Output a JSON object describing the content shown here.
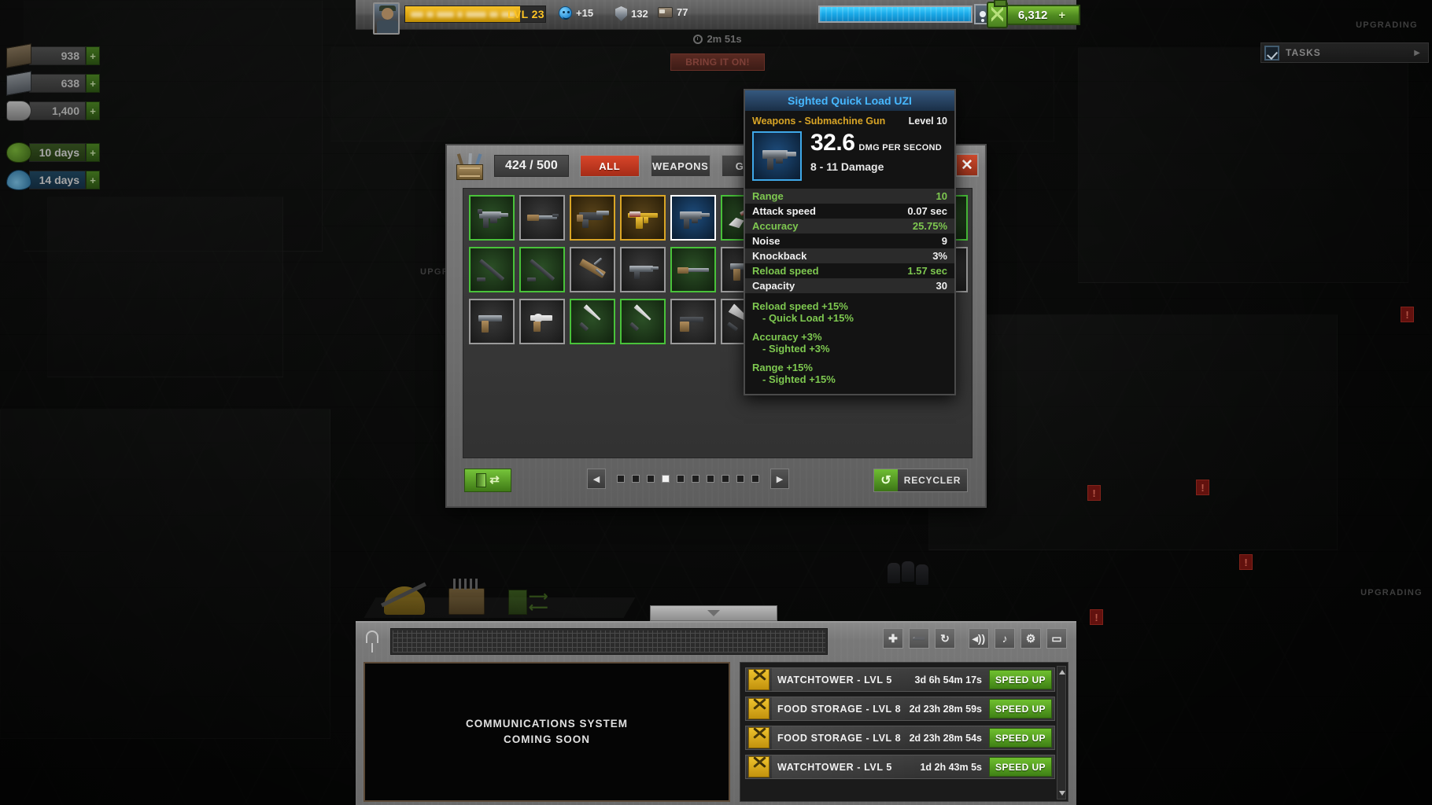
{
  "topbar": {
    "level_label": "LVL 23",
    "happiness": "+15",
    "defense": "132",
    "beds": "77",
    "fuel": "6,312",
    "fuel_plus": "+",
    "add_survivor_icon": "add-user-icon"
  },
  "center": {
    "timer": "2m 51s",
    "raid_button": "BRING IT ON!"
  },
  "resources": [
    {
      "icon": "wood-icon",
      "value": "938",
      "plus": "+"
    },
    {
      "icon": "metal-icon",
      "value": "638",
      "plus": "+"
    },
    {
      "icon": "cloth-icon",
      "value": "1,400",
      "plus": "+"
    },
    {
      "icon": "food-icon",
      "value": "10 days",
      "plus": "+"
    },
    {
      "icon": "water-icon",
      "value": "14 days",
      "plus": "+"
    }
  ],
  "tasks": {
    "label": "TASKS",
    "arrow": "▶"
  },
  "world_labels": {
    "upgrading_right_top": "UPGRADING",
    "upgrading_left": "UPGRA",
    "upgrading_right_mid": "UPGRADING"
  },
  "inventory": {
    "capacity": "424 / 500",
    "tabs": [
      {
        "label": "ALL",
        "active": true
      },
      {
        "label": "WEAPONS",
        "active": false
      },
      {
        "label": "GEAR",
        "active": false
      }
    ],
    "close_icon": "close-icon",
    "crate_icon": "crate-icon",
    "items": [
      {
        "rarity": "green",
        "glyph": "smg"
      },
      {
        "rarity": "grey",
        "glyph": "rifle"
      },
      {
        "rarity": "gold",
        "glyph": "tommy"
      },
      {
        "rarity": "gold",
        "glyph": "goldak"
      },
      {
        "rarity": "blue",
        "glyph": "uzi"
      },
      {
        "rarity": "green",
        "glyph": "guitar"
      },
      {
        "rarity": "green",
        "glyph": "bat"
      },
      {
        "rarity": "green",
        "glyph": "assault"
      },
      {
        "rarity": "green",
        "glyph": "shotgun"
      },
      {
        "rarity": "green",
        "glyph": "machete"
      },
      {
        "rarity": "green",
        "glyph": "pipe"
      },
      {
        "rarity": "green",
        "glyph": "pipe"
      },
      {
        "rarity": "grey",
        "glyph": "spikebat"
      },
      {
        "rarity": "grey",
        "glyph": "smg2"
      },
      {
        "rarity": "green",
        "glyph": "rifle2"
      },
      {
        "rarity": "grey",
        "glyph": "pistol"
      },
      {
        "rarity": "grey",
        "glyph": "spikebat"
      },
      {
        "rarity": "grey",
        "glyph": "revolver"
      },
      {
        "rarity": "grey",
        "glyph": "pistol2"
      },
      {
        "rarity": "grey",
        "glyph": "revolver"
      },
      {
        "rarity": "grey",
        "glyph": "pistol"
      },
      {
        "rarity": "grey",
        "glyph": "revolver"
      },
      {
        "rarity": "green",
        "glyph": "knife"
      },
      {
        "rarity": "green",
        "glyph": "knife"
      },
      {
        "rarity": "grey",
        "glyph": "sawnoff"
      },
      {
        "rarity": "grey",
        "glyph": "chefknife"
      },
      {
        "rarity": "gold",
        "glyph": "carbine"
      },
      {
        "rarity": "green",
        "glyph": "wrench"
      },
      {
        "rarity": "grey",
        "glyph": "ammo"
      }
    ],
    "footer": {
      "swap_icon": "swap-icon",
      "prev": "◀",
      "next": "▶",
      "pages": 10,
      "active_page": 4,
      "recycler_label": "RECYCLER",
      "recycler_icon": "recycle-icon"
    }
  },
  "tooltip": {
    "title": "Sighted Quick Load UZI",
    "category": "Weapons - Submachine Gun",
    "level": "Level 10",
    "dps": "32.6",
    "dps_label": "DMG PER SECOND",
    "damage": "8 - 11 Damage",
    "item_icon": "uzi-icon",
    "stats": [
      {
        "name": "Range",
        "value": "10",
        "highlight": true
      },
      {
        "name": "Attack speed",
        "value": "0.07 sec",
        "highlight": false
      },
      {
        "name": "Accuracy",
        "value": "25.75%",
        "highlight": true
      },
      {
        "name": "Noise",
        "value": "9",
        "highlight": false
      },
      {
        "name": "Knockback",
        "value": "3%",
        "highlight": false
      },
      {
        "name": "Reload speed",
        "value": "1.57 sec",
        "highlight": true
      },
      {
        "name": "Capacity",
        "value": "30",
        "highlight": false
      }
    ],
    "bonuses": [
      {
        "main": "Reload speed +15%",
        "sub": "- Quick Load +15%"
      },
      {
        "main": "Accuracy +3%",
        "sub": "- Sighted +3%"
      },
      {
        "main": "Range +15%",
        "sub": "- Sighted +15%"
      }
    ]
  },
  "hud": {
    "buttons": [
      {
        "icon": "zoom-in-icon",
        "glyph": "✚"
      },
      {
        "icon": "zoom-out-icon",
        "glyph": "➖"
      },
      {
        "icon": "rotate-icon",
        "glyph": "↻"
      },
      {
        "icon": "sound-icon",
        "glyph": "◂))"
      },
      {
        "icon": "music-off-icon",
        "glyph": "♪"
      },
      {
        "icon": "settings-icon",
        "glyph": "⚙"
      },
      {
        "icon": "window-icon",
        "glyph": "▭"
      }
    ],
    "comms_line1": "COMMUNICATIONS SYSTEM",
    "comms_line2": "COMING SOON",
    "queue": [
      {
        "name": "WATCHTOWER - LVL 5",
        "time": "3d 6h 54m 17s",
        "action": "SPEED UP"
      },
      {
        "name": "FOOD STORAGE - LVL 8",
        "time": "2d 23h 28m 59s",
        "action": "SPEED UP"
      },
      {
        "name": "FOOD STORAGE - LVL 8",
        "time": "2d 23h 28m 54s",
        "action": "SPEED UP"
      },
      {
        "name": "WATCHTOWER - LVL 5",
        "time": "1d 2h 43m 5s",
        "action": "SPEED UP"
      }
    ]
  }
}
